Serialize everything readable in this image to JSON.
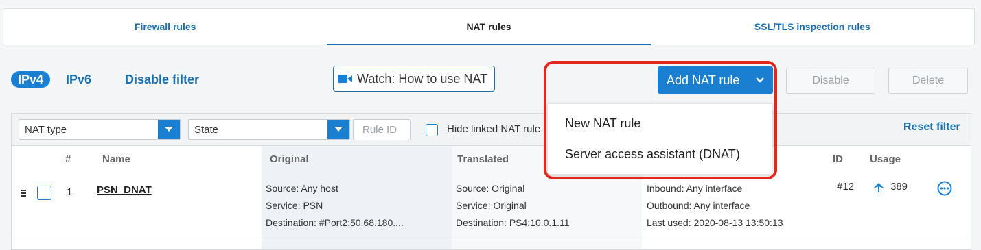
{
  "tabs": [
    {
      "label": "Firewall rules",
      "active": false
    },
    {
      "label": "NAT rules",
      "active": true
    },
    {
      "label": "SSL/TLS inspection rules",
      "active": false
    }
  ],
  "filters": {
    "ipv4": "IPv4",
    "ipv6": "IPv6",
    "disable_filter": "Disable filter"
  },
  "watch_label": "Watch: How to use NAT",
  "add_nat_rule": "Add NAT rule",
  "disable_label": "Disable",
  "delete_label": "Delete",
  "add_menu": [
    "New NAT rule",
    "Server access assistant (DNAT)"
  ],
  "filterbar": {
    "nat_type": "NAT type",
    "state": "State",
    "rule_id_placeholder": "Rule ID",
    "hide_linked": "Hide linked NAT rule",
    "reset_filter": "Reset filter"
  },
  "columns": {
    "num": "#",
    "name": "Name",
    "original": "Original",
    "translated": "Translated",
    "id": "ID",
    "usage": "Usage"
  },
  "rows": [
    {
      "num": "1",
      "name": "PSN_DNAT",
      "original": {
        "source": "Any host",
        "service": "PSN",
        "destination": "#Port2:50.68.180...."
      },
      "translated": {
        "source": "Original",
        "service": "Original",
        "destination": "PS4:10.0.1.11"
      },
      "interfaces": {
        "inbound": "Any interface",
        "outbound": "Any interface",
        "last_used": "2020-08-13 13:50:13"
      },
      "id": "#12",
      "usage": "389"
    }
  ],
  "labels": {
    "source": "Source:",
    "service": "Service:",
    "destination": "Destination:",
    "inbound": "Inbound:",
    "outbound": "Outbound:",
    "last_used": "Last used:"
  },
  "colors": {
    "accent": "#1a7fd1",
    "highlight": "#e3261b"
  }
}
